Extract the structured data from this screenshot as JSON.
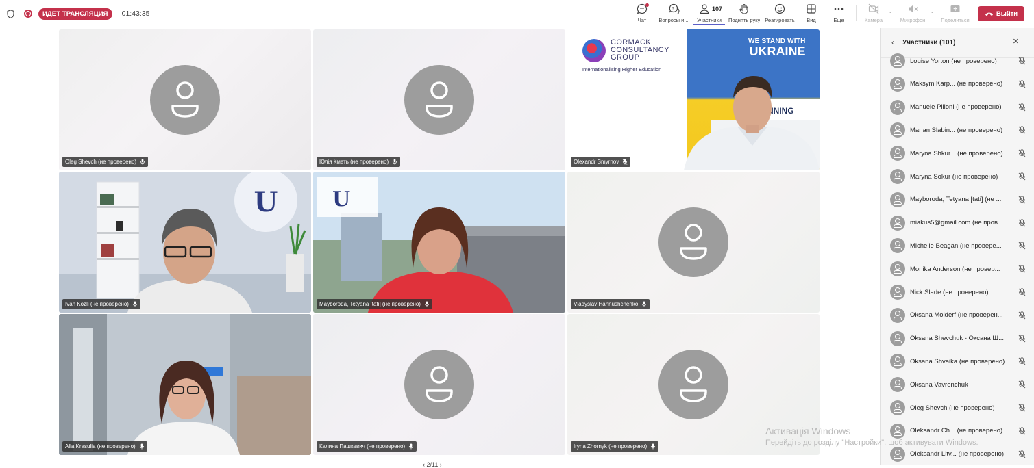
{
  "meeting": {
    "live_label": "ИДЕТ ТРАНСЛЯЦИЯ",
    "timer": "01:43:35"
  },
  "toolbar": {
    "chat": "Чат",
    "qa": "Вопросы и ...",
    "participants": "Участники",
    "participants_count": "107",
    "raise_hand": "Поднять руку",
    "react": "Реагировать",
    "view": "Вид",
    "more": "Еще",
    "camera": "Камера",
    "mic": "Микрофон",
    "share": "Поделиться",
    "leave": "Выйти"
  },
  "tiles": [
    {
      "name": "Oleg Shevch (не проверено)"
    },
    {
      "name": "Юлія Кметь (не проверено)"
    },
    {
      "name": "Olexandr Smyrnov"
    },
    {
      "name": "Ivan Kozli (не проверено)"
    },
    {
      "name": "Mayboroda, Tetyana [tati] (не проверено)"
    },
    {
      "name": "Vladyslav Hannushchenko"
    },
    {
      "name": "Alla Krasulia (не проверено)"
    },
    {
      "name": "Калина Пашкевич (не проверено)"
    },
    {
      "name": "Iryna Zhornyk (не проверено)"
    }
  ],
  "cormack": {
    "line1": "CORMACK",
    "line2": "CONSULTANCY",
    "line3": "GROUP",
    "tagline": "Internationalising Higher Education",
    "stand1": "WE STAND WITH",
    "stand2": "UKRAINE",
    "twinning": "TWINNING"
  },
  "pager": "2/11",
  "panel": {
    "title": "Участники (101)",
    "participants": [
      "Louise Yorton (не проверено)",
      "Maksym Karp...  (не проверено)",
      "Manuele Pilloni (не проверено)",
      "Marian Slabin...  (не проверено)",
      "Maryna Shkur...  (не проверено)",
      "Maryna Sokur (не проверено)",
      "Mayboroda, Tetyana [tati] (не ...",
      "miakus5@gmail.com (не пров...",
      "Michelle Beagan (не провере...",
      "Monika Anderson (не провер...",
      "Nick Slade (не проверено)",
      "Oksana Molderf (не проверен...",
      "Oksana Shevchuk - Оксана Ш...",
      "Oksana Shvaika (не проверено)",
      "Oksana Vavrenchuk",
      "Oleg Shevch (не проверено)",
      "Oleksandr Ch...  (не проверено)",
      "Oleksandr Litv...  (не проверено)"
    ]
  },
  "watermark": {
    "line1": "Активація Windows",
    "line2": "Перейдіть до розділу \"Настройки\", щоб активувати Windows."
  }
}
